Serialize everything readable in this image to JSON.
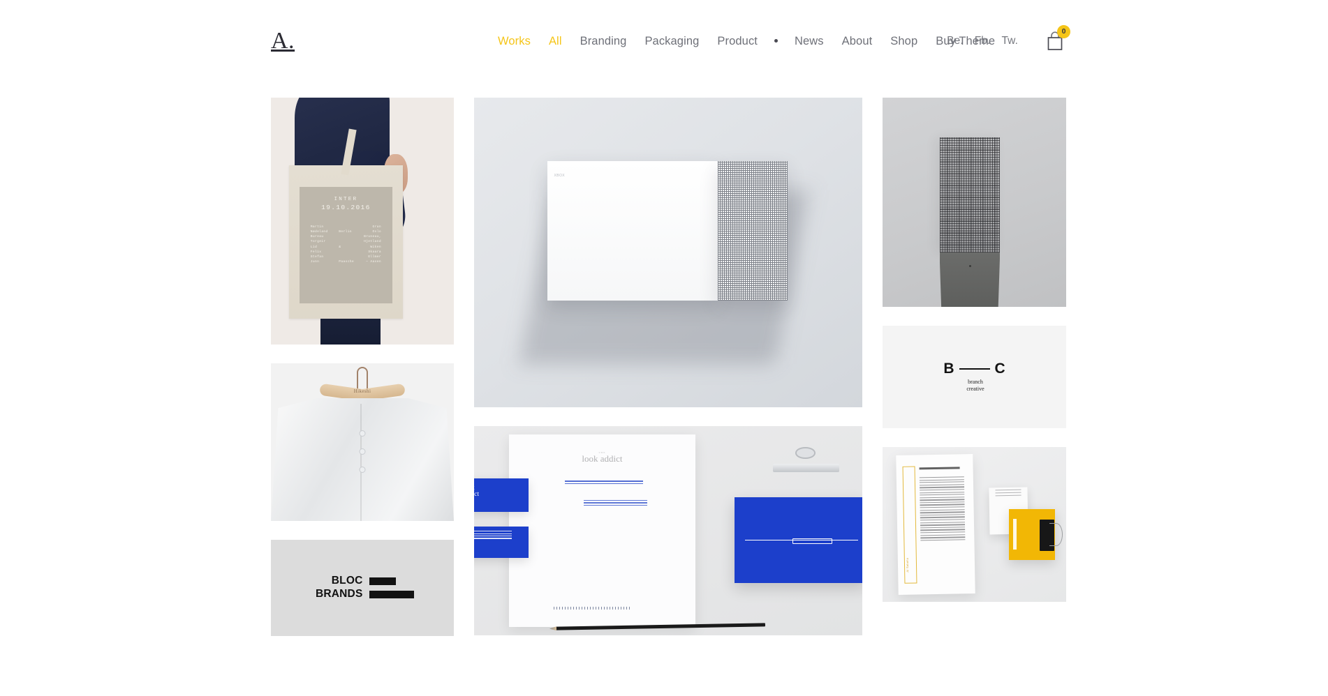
{
  "header": {
    "logo": "A.",
    "nav": [
      {
        "label": "Works",
        "state": "active"
      },
      {
        "label": "All",
        "state": "filter"
      },
      {
        "label": "Branding",
        "state": "normal"
      },
      {
        "label": "Packaging",
        "state": "normal"
      },
      {
        "label": "Product",
        "state": "normal"
      },
      {
        "label": "News",
        "state": "normal"
      },
      {
        "label": "About",
        "state": "normal"
      },
      {
        "label": "Shop",
        "state": "normal"
      },
      {
        "label": "Buy Theme",
        "state": "normal"
      }
    ],
    "social": [
      {
        "label": "Be."
      },
      {
        "label": "Fb."
      },
      {
        "label": "Tw."
      }
    ],
    "cart": {
      "icon": "shopping-bag-icon",
      "count": "0",
      "badge_color": "#f5c518"
    }
  },
  "colors": {
    "accent_yellow": "#f5c518",
    "nav_grey": "#6e7078",
    "logo_dark": "#2b2b33",
    "stationery_blue": "#1c3fcb",
    "letterhead_yellow": "#f2b705",
    "page_background": "#ffffff"
  },
  "gallery": {
    "columns": [
      {
        "name": "left",
        "tiles": [
          {
            "id": "tote-bag",
            "title": "INTER",
            "date": "19.10.2016",
            "names": [
              {
                "c1": "Martin",
                "c2": "",
                "c3": "Gran"
              },
              {
                "c1": "Nødeland",
                "c2": "Berlin",
                "c3": "Oslo"
              },
              {
                "c1": "Bureau",
                "c2": "",
                "c3": "Bruneau,"
              },
              {
                "c1": "Torgeir",
                "c2": "",
                "c3": "Hjetland"
              },
              {
                "c1": "Lid",
                "c2": "&",
                "c3": "Wiken"
              },
              {
                "c1": "Felix",
                "c2": "",
                "c3": "Skaara"
              },
              {
                "c1": "Stefan",
                "c2": "",
                "c3": "Ellmer"
              },
              {
                "c1": "Junn",
                "c2": "Paasche",
                "c3": "— Aasen"
              }
            ]
          },
          {
            "id": "hanger-jacket",
            "brand": "Hikeshi"
          },
          {
            "id": "bloc-brands",
            "line1": "BLOC",
            "line2": "BRANDS"
          }
        ]
      },
      {
        "name": "center",
        "tiles": [
          {
            "id": "white-console",
            "brand": "XBOX"
          },
          {
            "id": "look-addict-stationery",
            "brand": "look addict",
            "brand_sub": "THE"
          }
        ]
      },
      {
        "name": "right",
        "tiles": [
          {
            "id": "perforated-tower"
          },
          {
            "id": "branch-creative",
            "letter_left": "B",
            "letter_right": "C",
            "sub_line1": "branch",
            "sub_line2": "creative"
          },
          {
            "id": "yellow-letterhead",
            "sidebar_text": "Al Salama"
          }
        ]
      }
    ]
  }
}
